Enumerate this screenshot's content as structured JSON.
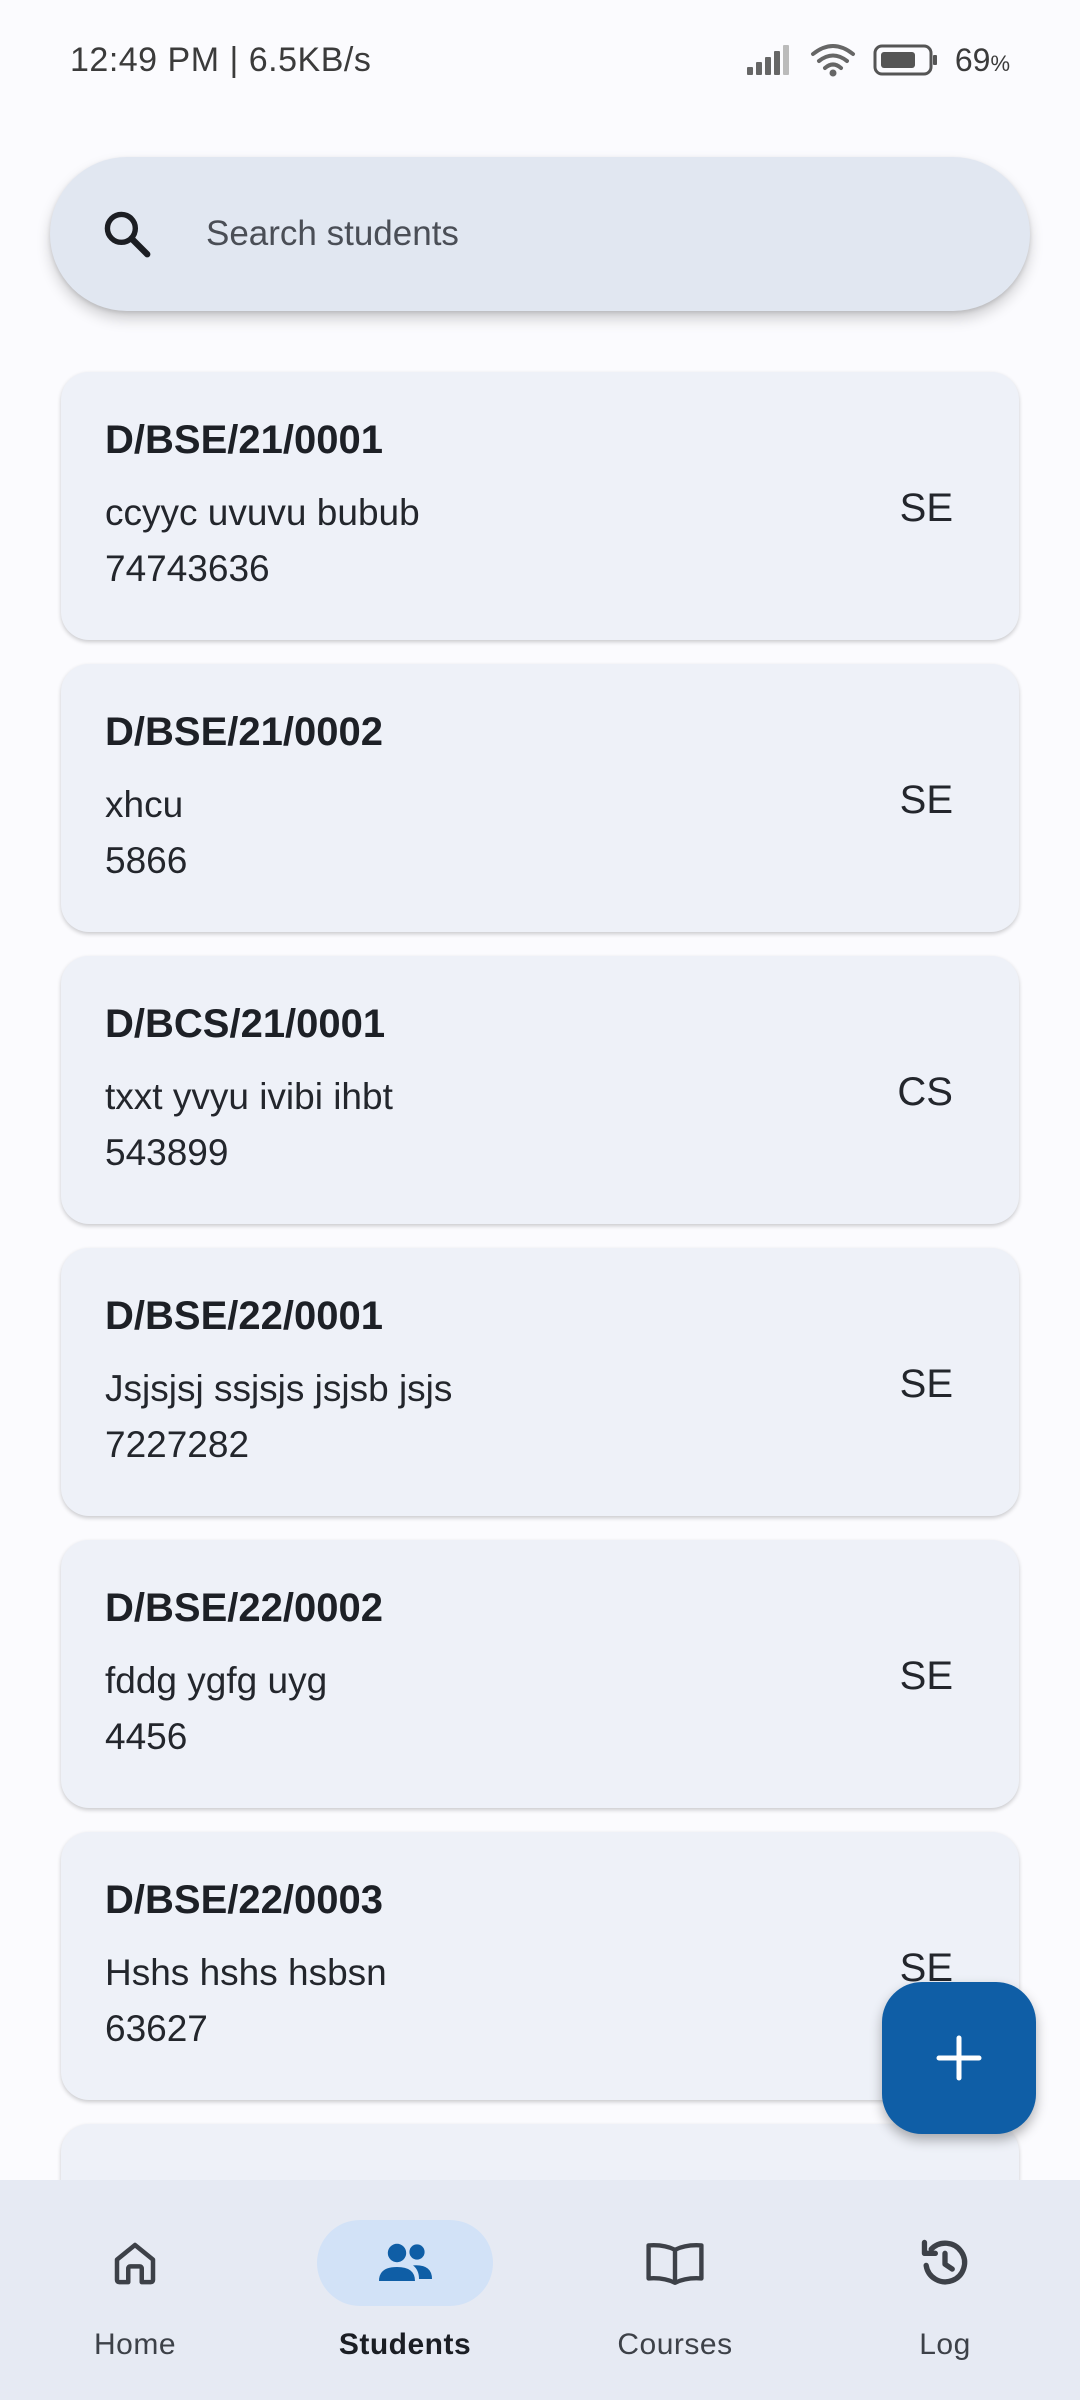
{
  "status_bar": {
    "time_speed": "12:49 PM | 6.5KB/s",
    "battery_level": "69",
    "battery_unit": "%"
  },
  "search": {
    "placeholder": "Search students",
    "icon": "search-icon"
  },
  "students": [
    {
      "id": "D/BSE/21/0001",
      "name": "ccyyc uvuvu bubub",
      "phone": "74743636",
      "dept": "SE"
    },
    {
      "id": "D/BSE/21/0002",
      "name": "xhcu",
      "phone": "5866",
      "dept": "SE"
    },
    {
      "id": "D/BCS/21/0001",
      "name": "txxt yvyu ivibi ihbt",
      "phone": "543899",
      "dept": "CS"
    },
    {
      "id": "D/BSE/22/0001",
      "name": "Jsjsjsj ssjsjs jsjsb jsjs",
      "phone": "7227282",
      "dept": "SE"
    },
    {
      "id": "D/BSE/22/0002",
      "name": "fddg ygfg uyg",
      "phone": "4456",
      "dept": "SE"
    },
    {
      "id": "D/BSE/22/0003",
      "name": "Hshs hshs hsbsn",
      "phone": "63627",
      "dept": "SE"
    }
  ],
  "fab": {
    "icon": "plus-icon"
  },
  "nav": {
    "items": [
      {
        "label": "Home",
        "icon": "home-icon",
        "active": false
      },
      {
        "label": "Students",
        "icon": "people-icon",
        "active": true
      },
      {
        "label": "Courses",
        "icon": "book-icon",
        "active": false
      },
      {
        "label": "Log",
        "icon": "history-icon",
        "active": false
      }
    ]
  },
  "colors": {
    "primary": "#0f5ea6",
    "nav_active_pill": "#d2e2f7",
    "card_background": "#eef1f8",
    "search_background": "#e1e7f1"
  }
}
